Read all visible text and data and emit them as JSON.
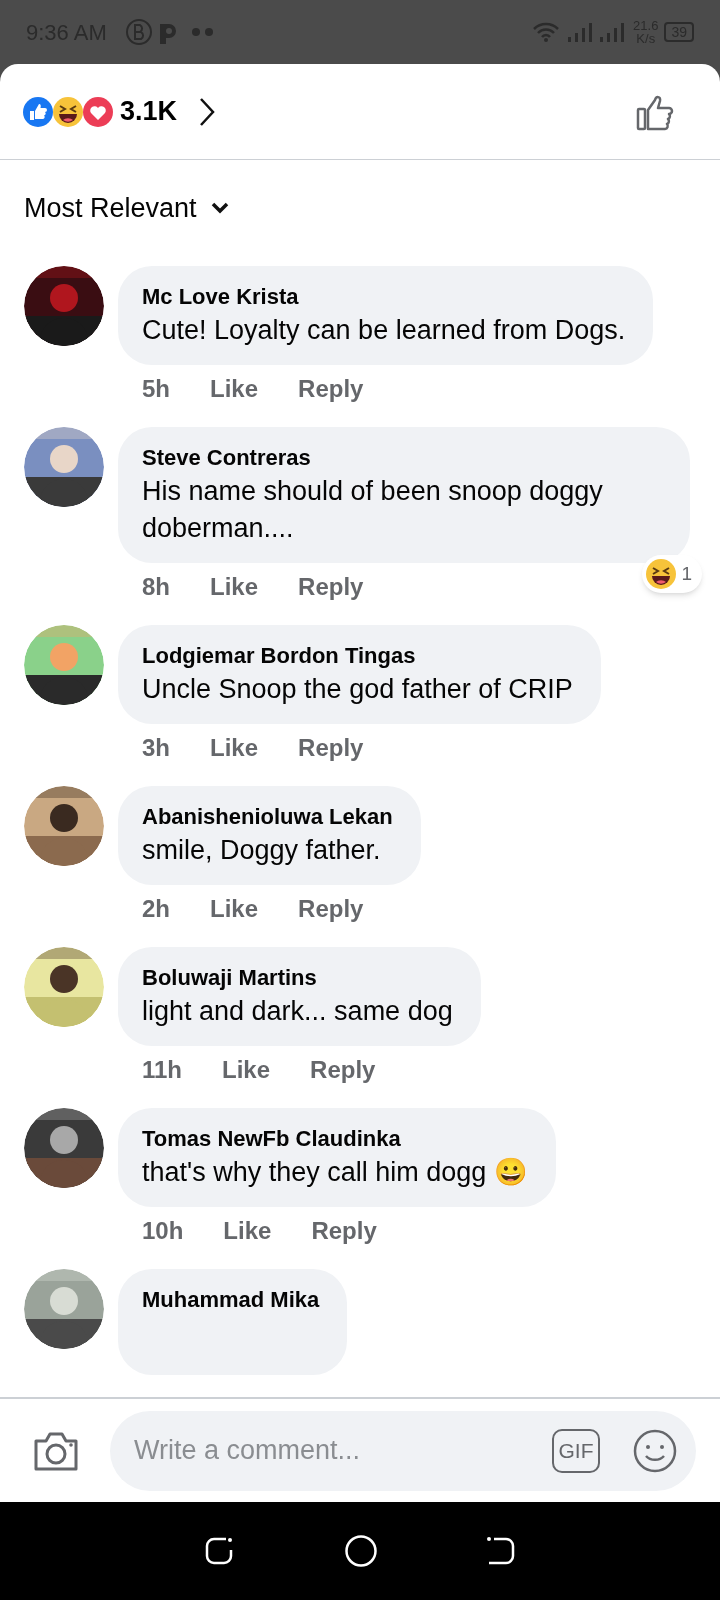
{
  "status_bar": {
    "time": "9:36 AM",
    "speed_value": "21.6",
    "speed_unit": "K/s",
    "battery": "39"
  },
  "header": {
    "reaction_count": "3.1K"
  },
  "sort": {
    "label": "Most Relevant"
  },
  "comments": [
    {
      "author": "Mc Love Krista",
      "text": "Cute! Loyalty can be learned from Dogs.",
      "time": "5h",
      "like": "Like",
      "reply": "Reply"
    },
    {
      "author": "Steve Contreras",
      "text": "His name should of been snoop doggy doberman....",
      "time": "8h",
      "like": "Like",
      "reply": "Reply",
      "reaction_count": "1"
    },
    {
      "author": "Lodgiemar Bordon Tingas",
      "text": "Uncle Snoop the god father of CRIP",
      "time": "3h",
      "like": "Like",
      "reply": "Reply"
    },
    {
      "author": "Abanishenioluwa Lekan",
      "text": "smile, Doggy father.",
      "time": "2h",
      "like": "Like",
      "reply": "Reply"
    },
    {
      "author": "Boluwaji Martins",
      "text": "light and dark... same dog",
      "time": "11h",
      "like": "Like",
      "reply": "Reply"
    },
    {
      "author": "Tomas NewFb Claudinka",
      "text": "that's why they call him dogg 😀",
      "time": "10h",
      "like": "Like",
      "reply": "Reply"
    },
    {
      "author": "Muhammad Mika"
    }
  ],
  "composer": {
    "placeholder": "Write a comment...",
    "gif": "GIF"
  }
}
